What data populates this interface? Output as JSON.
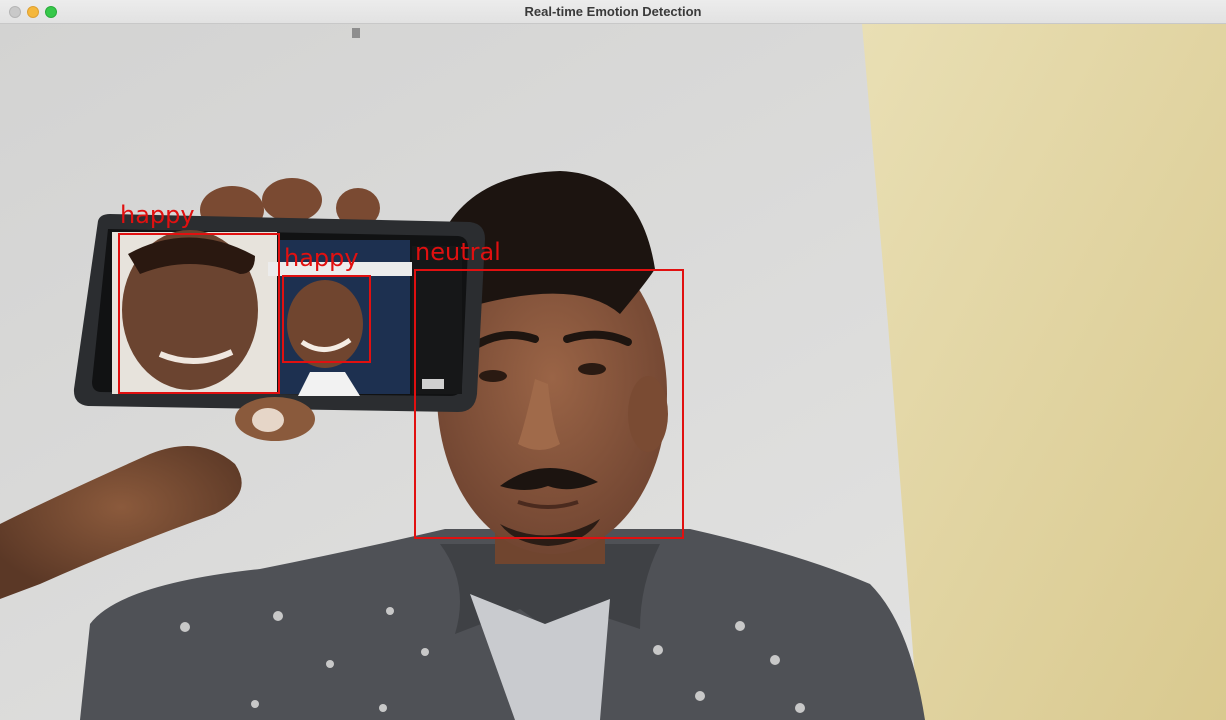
{
  "window": {
    "title": "Real-time Emotion Detection",
    "controls": [
      "close-button",
      "minimize-button",
      "zoom-button"
    ]
  },
  "detections": [
    {
      "label": "happy"
    },
    {
      "label": "happy"
    },
    {
      "label": "neutral"
    }
  ],
  "colors": {
    "box": "#e11010",
    "wall": "#dcdcda",
    "wall_right": "#e6d9a6",
    "shirt": "#505257",
    "skin": "#8a5a3c"
  }
}
